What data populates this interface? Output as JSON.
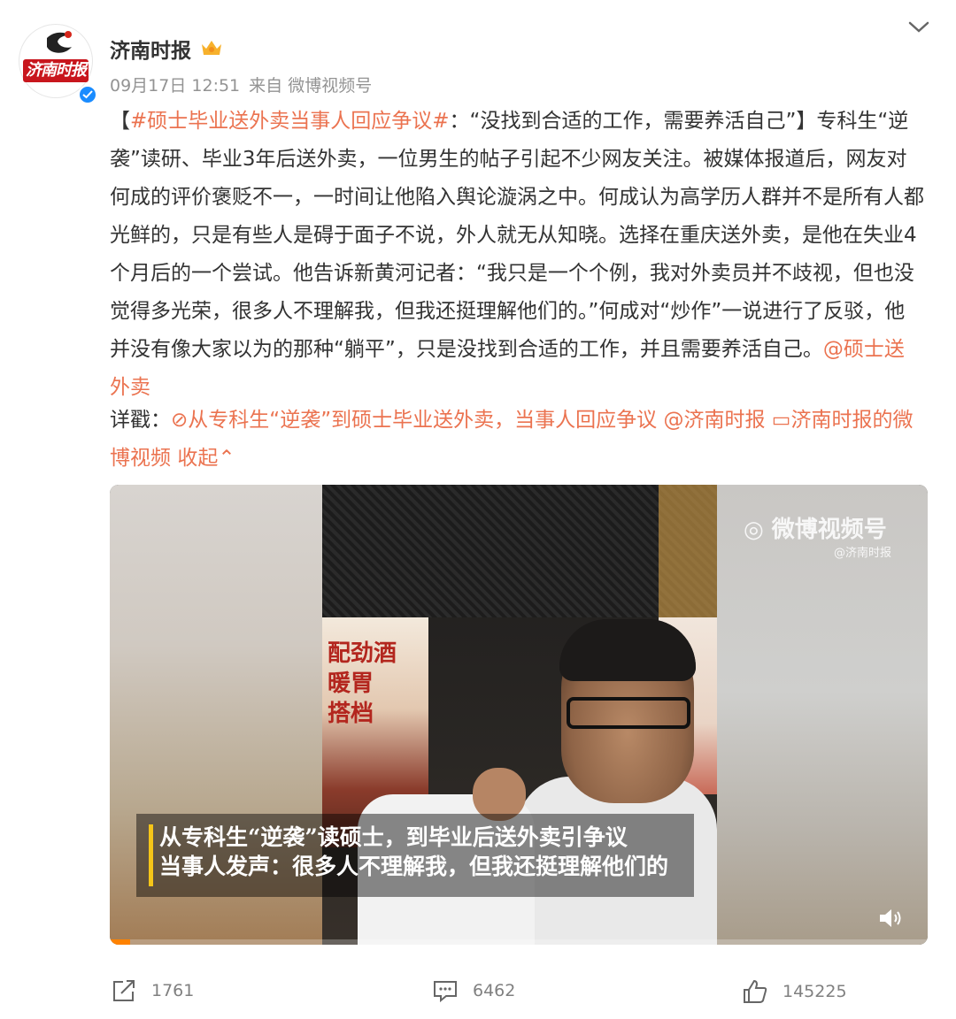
{
  "post": {
    "author": "济南时报",
    "avatar_text": "济南时报",
    "time": "09月17日 12:51",
    "source": "来自 微博视频号",
    "content": {
      "bracket_open": "【",
      "hashtag": "#硕士毕业送外卖当事人回应争议#",
      "body": "：“没找到合适的工作，需要养活自己”】专科生“逆袭”读研、毕业3年后送外卖，一位男生的帖子引起不少网友关注。被媒体报道后，网友对何成的评价褒贬不一，一时间让他陷入舆论漩涡之中。何成认为高学历人群并不是所有人都光鲜的，只是有些人是碍于面子不说，外人就无从知晓。选择在重庆送外卖，是他在失业4个月后的一个尝试。他告诉新黄河记者：“我只是一个个例，我对外卖员并不歧视，但也没觉得多光荣，很多人不理解我，但我还挺理解他们的。”何成对“炒作”一说进行了反驳，他并没有像大家以为的那种“躺平”，只是没找到合适的工作，并且需要养活自己。",
      "mention": "@硕士送外卖"
    },
    "details": {
      "label": "详戳：",
      "link1": "从专科生“逆袭”到硕士毕业送外卖，当事人回应争议",
      "mention": "@济南时报",
      "link2": "济南时报的微博视频",
      "collapse": "收起"
    },
    "video": {
      "watermark": "微博视频号",
      "watermark_sub": "@济南时报",
      "caption_line1": "从专科生“逆袭”读硕士，到毕业后送外卖引争议",
      "caption_line2": "当事人发声：很多人不理解我，但我还挺理解他们的",
      "poster_text": "配劲酒\n暖胃\n搭档",
      "progress": 0.025
    },
    "actions": {
      "repost": "1761",
      "comment": "6462",
      "like": "145225"
    },
    "colors": {
      "link": "#eb7350",
      "verified": "#1a8cff",
      "progress": "#ff8200",
      "caption_bar": "#f5c518"
    }
  }
}
